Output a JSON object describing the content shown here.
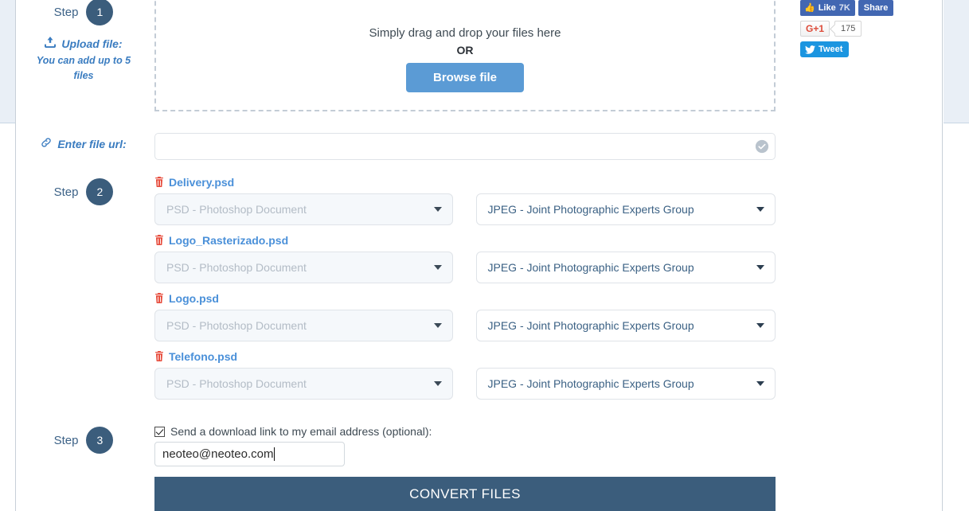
{
  "social": {
    "facebook": {
      "like_label": "Like",
      "like_count": "7K",
      "share_label": "Share",
      "icon": "thumbs-up-icon"
    },
    "google": {
      "label": "G+1",
      "count": "175"
    },
    "twitter": {
      "label": "Tweet",
      "icon": "twitter-bird-icon"
    }
  },
  "steps": {
    "word": "Step",
    "one": "1",
    "two": "2",
    "three": "3"
  },
  "upload": {
    "label": "Upload file:",
    "sublabel": "You can add up to 5 files",
    "icon": "upload-icon"
  },
  "url": {
    "label": "Enter file url:",
    "icon": "link-icon",
    "value": "",
    "placeholder": "",
    "valid_icon": "check-circle-icon"
  },
  "dropzone": {
    "text": "Simply drag and drop your files here",
    "or": "OR",
    "browse_label": "Browse file"
  },
  "files": [
    {
      "name": "Delivery.psd",
      "from_format": "PSD - Photoshop Document",
      "to_format": "JPEG - Joint Photographic Experts Group",
      "delete_icon": "trash-icon"
    },
    {
      "name": "Logo_Rasterizado.psd",
      "from_format": "PSD - Photoshop Document",
      "to_format": "JPEG - Joint Photographic Experts Group",
      "delete_icon": "trash-icon"
    },
    {
      "name": "Logo.psd",
      "from_format": "PSD - Photoshop Document",
      "to_format": "JPEG - Joint Photographic Experts Group",
      "delete_icon": "trash-icon"
    },
    {
      "name": "Telefono.psd",
      "from_format": "PSD - Photoshop Document",
      "to_format": "JPEG - Joint Photographic Experts Group",
      "delete_icon": "trash-icon"
    }
  ],
  "email": {
    "checkbox_label": "Send a download link to my email address (optional):",
    "checked": true,
    "value": "neoteo@neoteo.com"
  },
  "convert": {
    "label": "CONVERT FILES"
  },
  "colors": {
    "step_circle": "#3b5d7c",
    "accent_blue": "#3a7cc0",
    "browse_blue": "#5b9bd5",
    "convert_blue": "#3b5d7c",
    "trash_red": "#e74c3c",
    "filename_blue": "#4a90d9",
    "gutter_blue": "#e9eff6"
  }
}
